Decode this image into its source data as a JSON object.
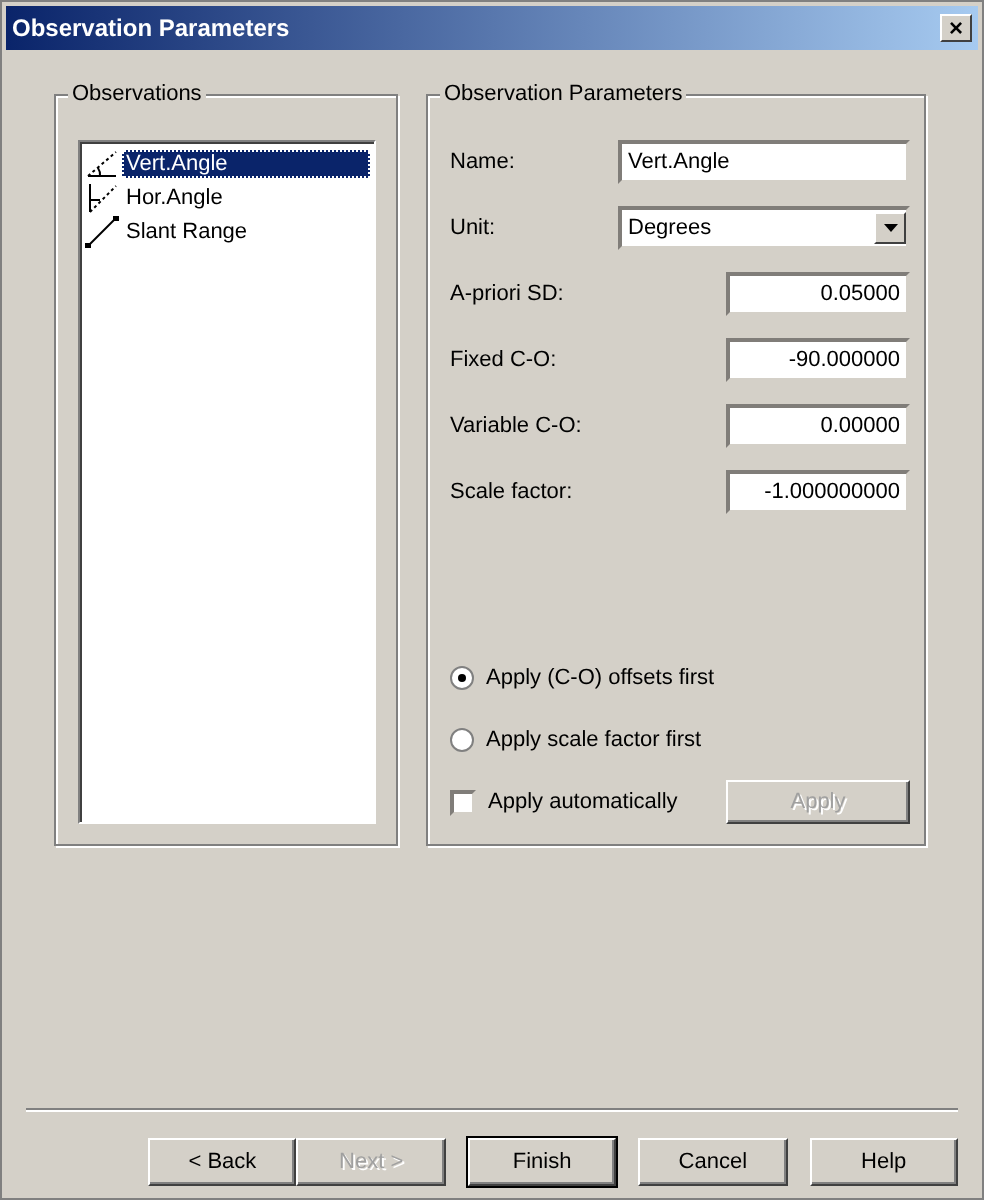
{
  "window": {
    "title": "Observation Parameters",
    "close": "×"
  },
  "observations": {
    "title": "Observations",
    "items": [
      {
        "label": "Vert.Angle",
        "kind": "vertical",
        "selected": true
      },
      {
        "label": "Hor.Angle",
        "kind": "horizontal",
        "selected": false
      },
      {
        "label": "Slant Range",
        "kind": "slant",
        "selected": false
      }
    ]
  },
  "parameters": {
    "title": "Observation Parameters",
    "name": {
      "label": "Name:",
      "value": "Vert.Angle"
    },
    "unit": {
      "label": "Unit:",
      "value": "Degrees"
    },
    "fields": [
      {
        "label": "A-priori SD:",
        "value": "0.05000"
      },
      {
        "label": "Fixed C-O:",
        "value": "-90.000000"
      },
      {
        "label": "Variable C-O:",
        "value": "0.00000"
      },
      {
        "label": "Scale factor:",
        "value": "-1.000000000"
      }
    ],
    "order": [
      {
        "label": "Apply (C-O) offsets first",
        "selected": true
      },
      {
        "label": "Apply scale factor first",
        "selected": false
      }
    ],
    "auto": {
      "label": "Apply automatically",
      "checked": false
    },
    "apply": {
      "label": "Apply",
      "disabled": true
    }
  },
  "buttons": [
    {
      "label": "< Back",
      "disabled": false,
      "default": false
    },
    {
      "label": "Next >",
      "disabled": true,
      "default": false
    },
    {
      "label": "Finish",
      "disabled": false,
      "default": true
    },
    {
      "label": "Cancel",
      "disabled": false,
      "default": false
    },
    {
      "label": "Help",
      "disabled": false,
      "default": false
    }
  ]
}
